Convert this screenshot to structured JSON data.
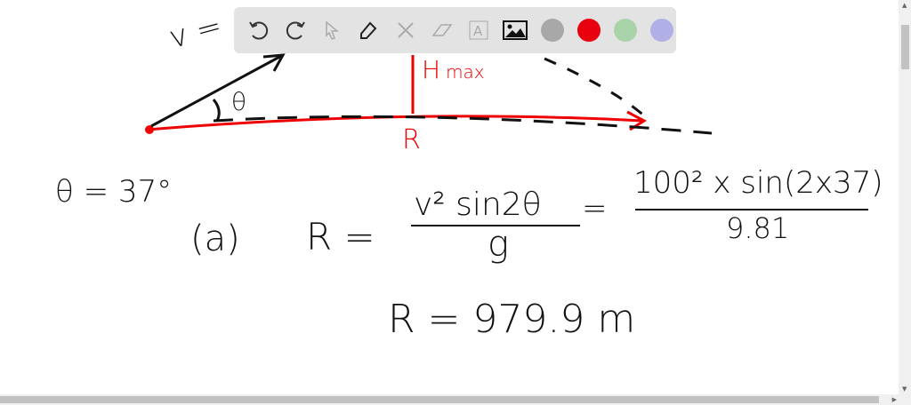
{
  "board": {
    "v_label": "v =",
    "theta_label": "θ",
    "hmax_label": "H",
    "hmax_sub": "max",
    "range_label": "R",
    "given": "θ = 37°",
    "part": "(a)",
    "eq_lhs": "R =",
    "eq_num": "v² sin2θ",
    "eq_den": "g",
    "eq_equals": "=",
    "eq_num2": "100² x sin(2x37)",
    "eq_den2": "9.81",
    "result": "R = 979.9 m"
  },
  "toolbar": {
    "colors": [
      "#a8a8a8",
      "#e8000f",
      "#a9d3a9",
      "#b0b0e6"
    ]
  }
}
